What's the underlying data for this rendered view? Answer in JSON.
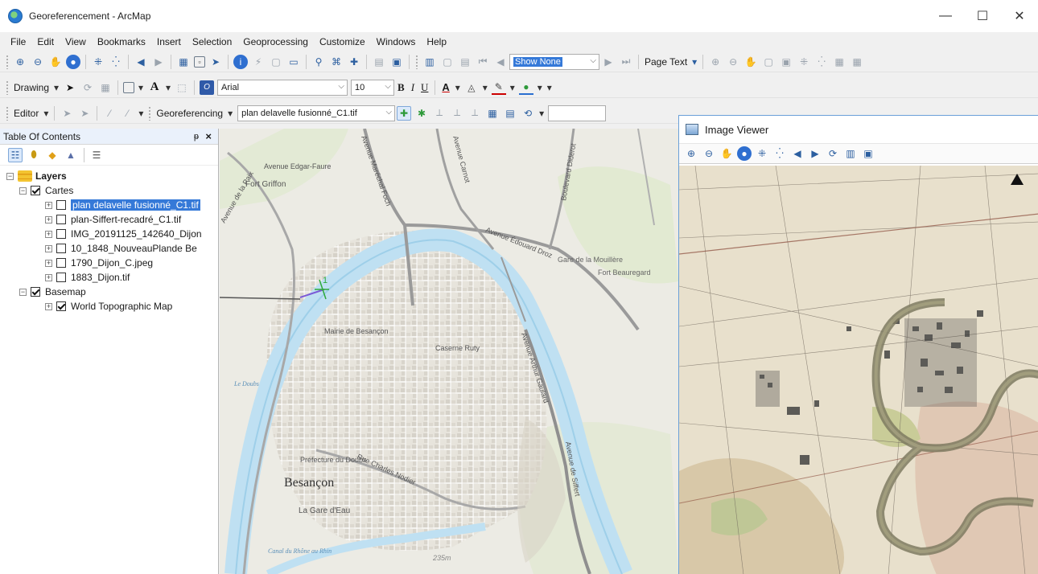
{
  "window": {
    "title": "Georeferencement - ArcMap",
    "minimize": "—",
    "maximize": "☐",
    "close": "✕"
  },
  "menu": [
    "File",
    "Edit",
    "View",
    "Bookmarks",
    "Insert",
    "Selection",
    "Geoprocessing",
    "Customize",
    "Windows",
    "Help"
  ],
  "toolbar1": {
    "selected_dropdown": "Show None",
    "page_text": "Page Text"
  },
  "drawing_toolbar": {
    "label": "Drawing",
    "font_name": "Arial",
    "font_size": "10",
    "bold": "B",
    "italic": "I",
    "underline": "U",
    "font_color": "A"
  },
  "georef_toolbar": {
    "editor_label": "Editor",
    "georeferencing_label": "Georeferencing",
    "layer_dropdown": "plan delavelle fusionné_C1.tif"
  },
  "toc": {
    "title": "Table Of Contents",
    "pin": "ᵽ",
    "close": "×",
    "root": "Layers",
    "groups": [
      {
        "name": "Cartes",
        "checked": true,
        "layers": [
          {
            "name": "plan delavelle fusionné_C1.tif",
            "checked": false,
            "selected": true
          },
          {
            "name": "plan-Siffert-recadré_C1.tif",
            "checked": false,
            "selected": false
          },
          {
            "name": "IMG_20191125_142640_Dijon",
            "checked": false,
            "selected": false
          },
          {
            "name": "10_1848_NouveauPlande Be",
            "checked": false,
            "selected": false
          },
          {
            "name": "1790_Dijon_C.jpeg",
            "checked": false,
            "selected": false
          },
          {
            "name": "1883_Dijon.tif",
            "checked": false,
            "selected": false
          }
        ]
      },
      {
        "name": "Basemap",
        "checked": true,
        "layers": [
          {
            "name": "World Topographic Map",
            "checked": true,
            "selected": false
          }
        ]
      }
    ]
  },
  "map_labels": {
    "city": "Besançon",
    "avenue_foch": "Avenue Maréchal Foch",
    "fort_griffon": "Fort Griffon",
    "avenue_edgar": "Avenue Edgar-Faure",
    "avenue_carnot": "Avenue Carnot",
    "avenue_droz": "Avenue Édouard Droz",
    "gare_mouillere": "Gare de la Mouillère",
    "fort_beauregard": "Fort Beauregard",
    "mairie": "Mairie de Besançon",
    "caserne": "Caserne Ruty",
    "prefecture": "Préfecture du Doubs",
    "gare_eau": "La Gare d'Eau",
    "avenue_gaulard": "Avenue Arthur Gaulard",
    "avenue_siffert": "Avenue de Siffert",
    "rue_charles_nodier": "Rue Charles Nodier",
    "canal": "Canal du Rhône au Rhin",
    "elevation": "235m",
    "le_doubs": "Le Doubs",
    "avenue_paix": "Avenue de la Paix",
    "boulevard_diderot": "Boulevard Diderot",
    "control_point": "1"
  },
  "viewer": {
    "title": "Image Viewer"
  }
}
